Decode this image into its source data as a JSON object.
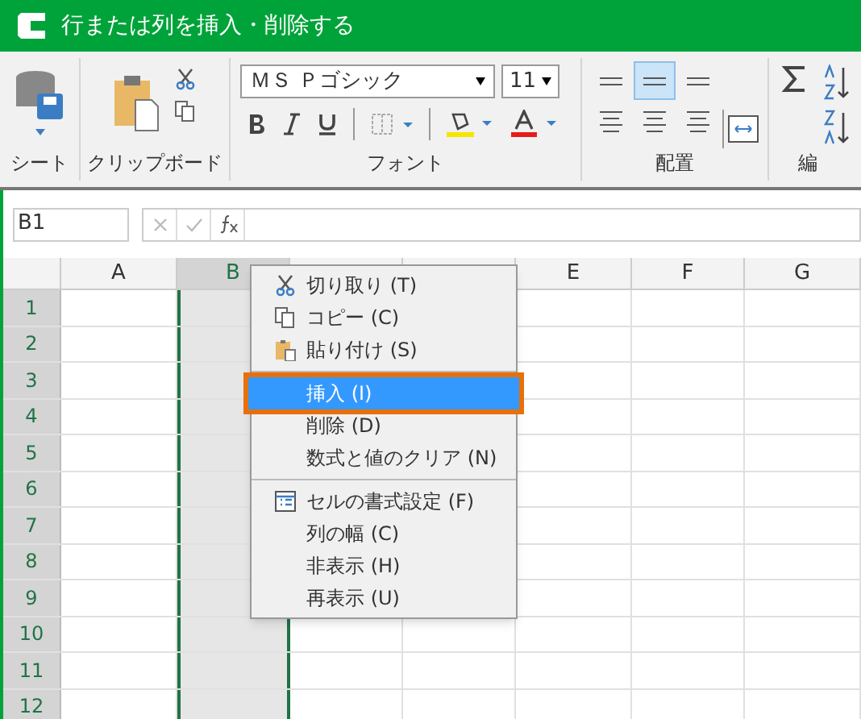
{
  "window": {
    "title": "行または列を挿入・削除する"
  },
  "ribbon": {
    "groups": [
      {
        "label": "シート"
      },
      {
        "label": "クリップボード"
      },
      {
        "label": "フォント"
      },
      {
        "label": "配置"
      },
      {
        "label": "編"
      }
    ],
    "font_name": "ＭＳ Ｐゴシック",
    "font_size": "11",
    "alignment_buttons": [
      {
        "selected": false
      },
      {
        "selected": true
      },
      {
        "selected": false
      },
      {
        "selected": false
      },
      {
        "selected": false
      },
      {
        "selected": false
      }
    ]
  },
  "formula_bar": {
    "name_box": "B1"
  },
  "sheet": {
    "columns": [
      {
        "label": "A",
        "selected": false
      },
      {
        "label": "B",
        "selected": true
      },
      {
        "selected": false
      },
      {
        "selected": false
      },
      {
        "label": "E",
        "selected": false
      },
      {
        "label": "F",
        "selected": false
      },
      {
        "label": "G",
        "selected": false
      }
    ],
    "rows": [
      "1",
      "2",
      "3",
      "4",
      "5",
      "6",
      "7",
      "8",
      "9",
      "10",
      "11",
      "12"
    ]
  },
  "context_menu": {
    "groups": [
      [
        {
          "label": "切り取り (T)",
          "kind": "cut",
          "selected": false
        },
        {
          "label": "コピー (C)",
          "kind": "copy",
          "selected": false
        },
        {
          "label": "貼り付け (S)",
          "kind": "paste",
          "selected": false
        }
      ],
      [
        {
          "label": "挿入 (I)",
          "kind": "plain",
          "selected": true
        },
        {
          "label": "削除 (D)",
          "kind": "plain",
          "selected": false
        },
        {
          "label": "数式と値のクリア (N)",
          "kind": "plain",
          "selected": false
        }
      ],
      [
        {
          "label": "セルの書式設定 (F)",
          "kind": "format",
          "selected": false
        },
        {
          "label": "列の幅 (C)",
          "kind": "plain",
          "selected": false
        },
        {
          "label": "非表示 (H)",
          "kind": "plain",
          "selected": false
        },
        {
          "label": "再表示 (U)",
          "kind": "plain",
          "selected": false
        }
      ]
    ]
  }
}
